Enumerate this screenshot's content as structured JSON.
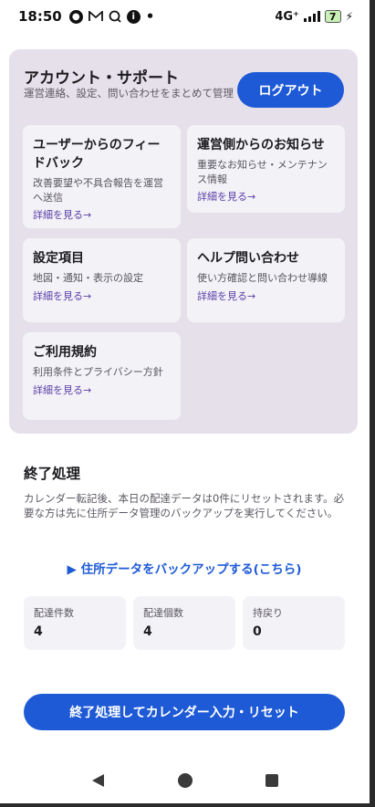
{
  "status_bar": {
    "time": "18:50",
    "network": "4G⁺",
    "battery": "7"
  },
  "support": {
    "title": "アカウント・サポート",
    "subtitle": "運営連絡、設定、問い合わせをまとめて管理",
    "logout_label": "ログアウト",
    "tiles": [
      {
        "title": "ユーザーからのフィードバック",
        "desc": "改善要望や不具合報告を運営へ送信",
        "link": "詳細を見る→"
      },
      {
        "title": "運営側からのお知らせ",
        "desc": "重要なお知らせ・メンテナンス情報",
        "link": "詳細を見る→"
      },
      {
        "title": "設定項目",
        "desc": "地図・通知・表示の設定",
        "link": "詳細を見る→"
      },
      {
        "title": "ヘルプ問い合わせ",
        "desc": "使い方確認と問い合わせ導線",
        "link": "詳細を見る→"
      },
      {
        "title": "ご利用規約",
        "desc": "利用条件とプライバシー方針",
        "link": "詳細を見る→"
      }
    ]
  },
  "end_section": {
    "title": "終了処理",
    "description": "カレンダー転記後、本日の配達データは0件にリセットされます。必要な方は先に住所データ管理のバックアップを実行してください。",
    "backup_link": "▶ 住所データをバックアップする(こちら)",
    "stats": [
      {
        "label": "配達件数",
        "value": "4"
      },
      {
        "label": "配達個数",
        "value": "4"
      },
      {
        "label": "持戻り",
        "value": "0"
      }
    ],
    "reset_button": "終了処理してカレンダー入力・リセット"
  }
}
